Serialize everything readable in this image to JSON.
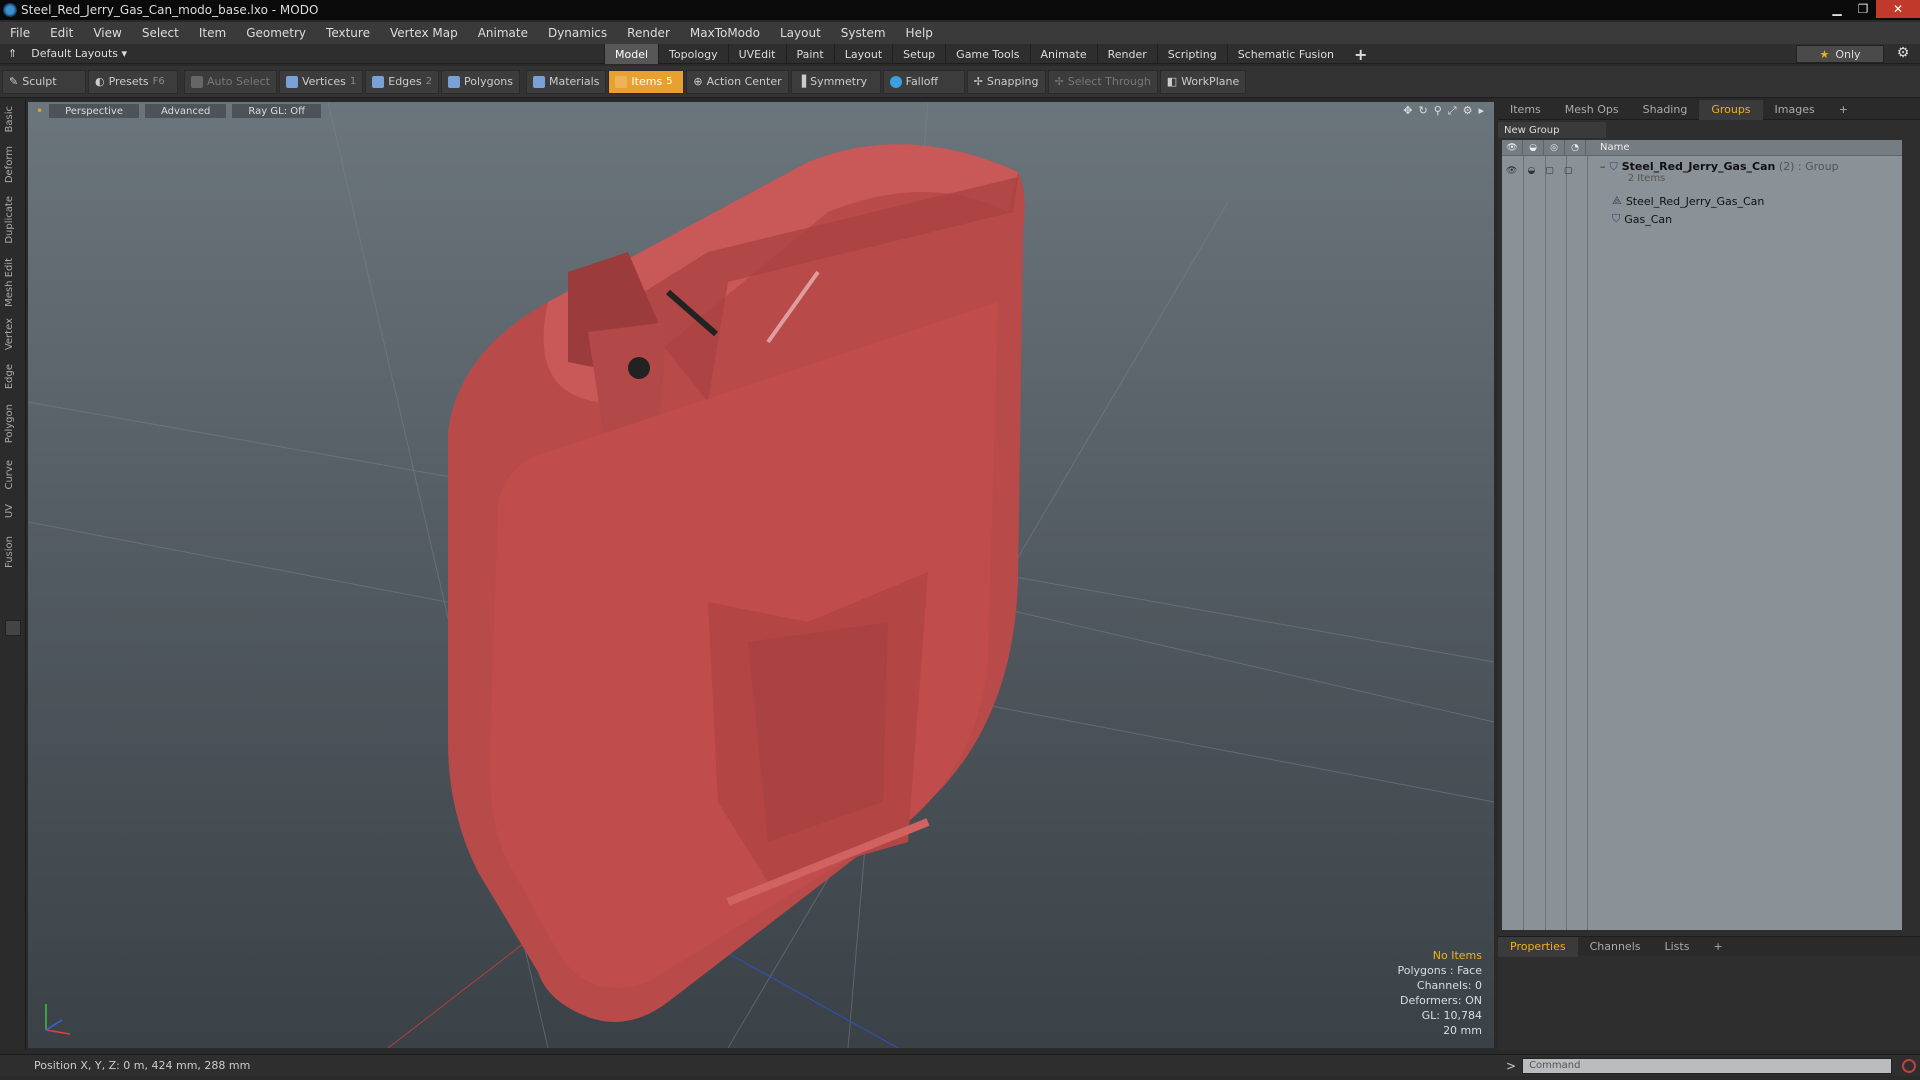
{
  "window": {
    "title": "Steel_Red_Jerry_Gas_Can_modo_base.lxo - MODO"
  },
  "menu": [
    "File",
    "Edit",
    "View",
    "Select",
    "Item",
    "Geometry",
    "Texture",
    "Vertex Map",
    "Animate",
    "Dynamics",
    "Render",
    "MaxToModo",
    "Layout",
    "System",
    "Help"
  ],
  "layoutbar": {
    "layouts_label": "Default Layouts ▾",
    "tabs": [
      "Model",
      "Topology",
      "UVEdit",
      "Paint",
      "Layout",
      "Setup",
      "Game Tools",
      "Animate",
      "Render",
      "Scripting",
      "Schematic Fusion"
    ],
    "active_tab": "Model",
    "only_label": "Only"
  },
  "toolbar": {
    "sculpt": "Sculpt",
    "presets": "Presets",
    "presets_key": "F6",
    "auto_select": "Auto Select",
    "vertices": "Vertices",
    "vertices_key": "1",
    "edges": "Edges",
    "edges_key": "2",
    "polygons": "Polygons",
    "materials": "Materials",
    "items": "Items",
    "items_key": "5",
    "action_center": "Action Center",
    "symmetry": "Symmetry",
    "falloff": "Falloff",
    "snapping": "Snapping",
    "select_through": "Select Through",
    "workplane": "WorkPlane"
  },
  "left_tabs": [
    "Basic",
    "Deform",
    "Duplicate",
    "Mesh Edit",
    "Vertex",
    "Edge",
    "Polygon",
    "Curve",
    "UV",
    "Fusion"
  ],
  "viewport": {
    "view": "Perspective",
    "mode": "Advanced",
    "raygl": "Ray GL: Off",
    "stats": {
      "items": "No Items",
      "polygons": "Polygons : Face",
      "channels": "Channels: 0",
      "deformers": "Deformers: ON",
      "gl": "GL: 10,784",
      "grid": "20 mm"
    }
  },
  "right_panel": {
    "tabs": [
      "Items",
      "Mesh Ops",
      "Shading",
      "Groups",
      "Images"
    ],
    "active_tab": "Groups",
    "new_group": "New Group",
    "column_name": "Name",
    "group": {
      "name": "Steel_Red_Jerry_Gas_Can",
      "count": "(2)",
      "type": ": Group",
      "subtitle": "2 Items",
      "children": [
        "Steel_Red_Jerry_Gas_Can",
        "Gas_Can"
      ]
    },
    "props_tabs": [
      "Properties",
      "Channels",
      "Lists"
    ],
    "props_active": "Properties"
  },
  "status": {
    "position": "Position X, Y, Z:  0 m, 424 mm, 288 mm"
  },
  "command": {
    "placeholder": "Command"
  }
}
